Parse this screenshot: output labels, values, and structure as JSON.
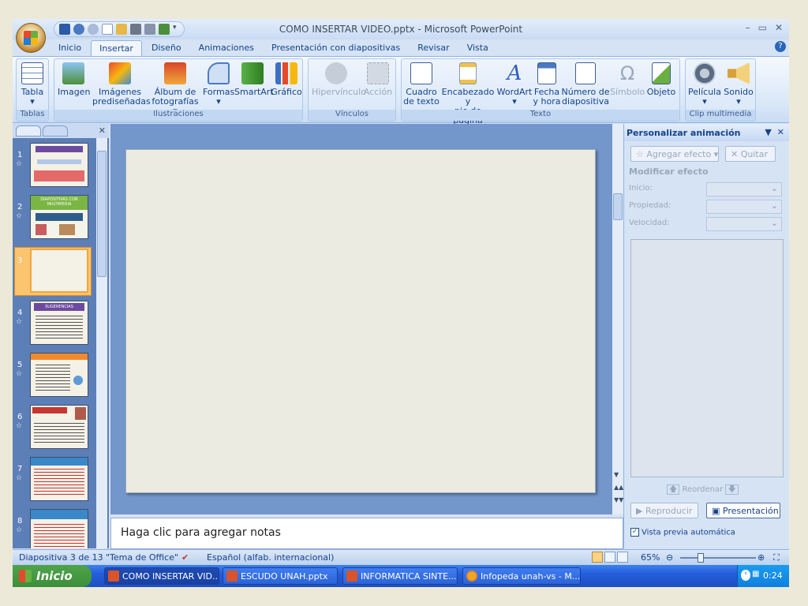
{
  "app": {
    "title": "COMO INSERTAR VIDEO.pptx - Microsoft PowerPoint"
  },
  "ribbon_tabs": [
    "Inicio",
    "Insertar",
    "Diseño",
    "Animaciones",
    "Presentación con diapositivas",
    "Revisar",
    "Vista"
  ],
  "ribbon": {
    "groups": {
      "tablas": "Tablas",
      "ilustraciones": "Ilustraciones",
      "vinculos": "Vínculos",
      "texto": "Texto",
      "clip": "Clip multimedia"
    },
    "buttons": {
      "tabla": [
        "Tabla",
        "▾"
      ],
      "imagen": "Imagen",
      "imagenes_predisenadas": [
        "Imágenes",
        "prediseñadas"
      ],
      "album": [
        "Álbum de",
        "fotografías ▾"
      ],
      "formas": [
        "Formas",
        "▾"
      ],
      "smartart": "SmartArt",
      "grafico": "Gráfico",
      "hipervinculo": "Hipervínculo",
      "accion": "Acción",
      "cuadro_texto": [
        "Cuadro",
        "de texto"
      ],
      "encabezado": [
        "Encabezado y",
        "pie de página"
      ],
      "wordart": [
        "WordArt",
        "▾"
      ],
      "fecha": [
        "Fecha",
        "y hora"
      ],
      "numero": [
        "Número de",
        "diapositiva"
      ],
      "simbolo": "Símbolo",
      "objeto": "Objeto",
      "pelicula": [
        "Película",
        "▾"
      ],
      "sonido": [
        "Sonido",
        "▾"
      ]
    }
  },
  "slides": {
    "numbers": [
      "1",
      "2",
      "3",
      "4",
      "5",
      "6",
      "7",
      "8"
    ],
    "selected": "3",
    "thumb_titles": {
      "t2": "DIAPOSITIVAS CON MULTIMEDIA",
      "t4": "SUGERENCIAS"
    }
  },
  "notes": {
    "placeholder": "Haga clic para agregar notas"
  },
  "task_pane": {
    "title": "Personalizar animación",
    "add_effect": "Agregar efecto",
    "remove": "Quitar",
    "modify_effect": "Modificar efecto",
    "start_label": "Inicio:",
    "property_label": "Propiedad:",
    "speed_label": "Velocidad:",
    "reorder": "Reordenar",
    "play": "Reproducir",
    "slideshow": "Presentación",
    "auto_preview": "Vista previa automática"
  },
  "status_bar": {
    "slide_info": "Diapositiva 3 de 13",
    "theme": "\"Tema de Office\"",
    "language": "Español (alfab. internacional)",
    "zoom": "65%"
  },
  "taskbar": {
    "start": "Inicio",
    "items": [
      "COMO INSERTAR VID...",
      "ESCUDO UNAH.pptx",
      "INFORMATICA SINTE...",
      "Infopeda unah-vs - M..."
    ],
    "time": "0:24"
  },
  "colors": {
    "ribbon_bg": "#d5e3f5",
    "slide_area": "#7396cb",
    "slide": "#ecebe2",
    "selection": "#fbc46f",
    "taskbar": "#245ddb",
    "start": "#3c8f38"
  }
}
